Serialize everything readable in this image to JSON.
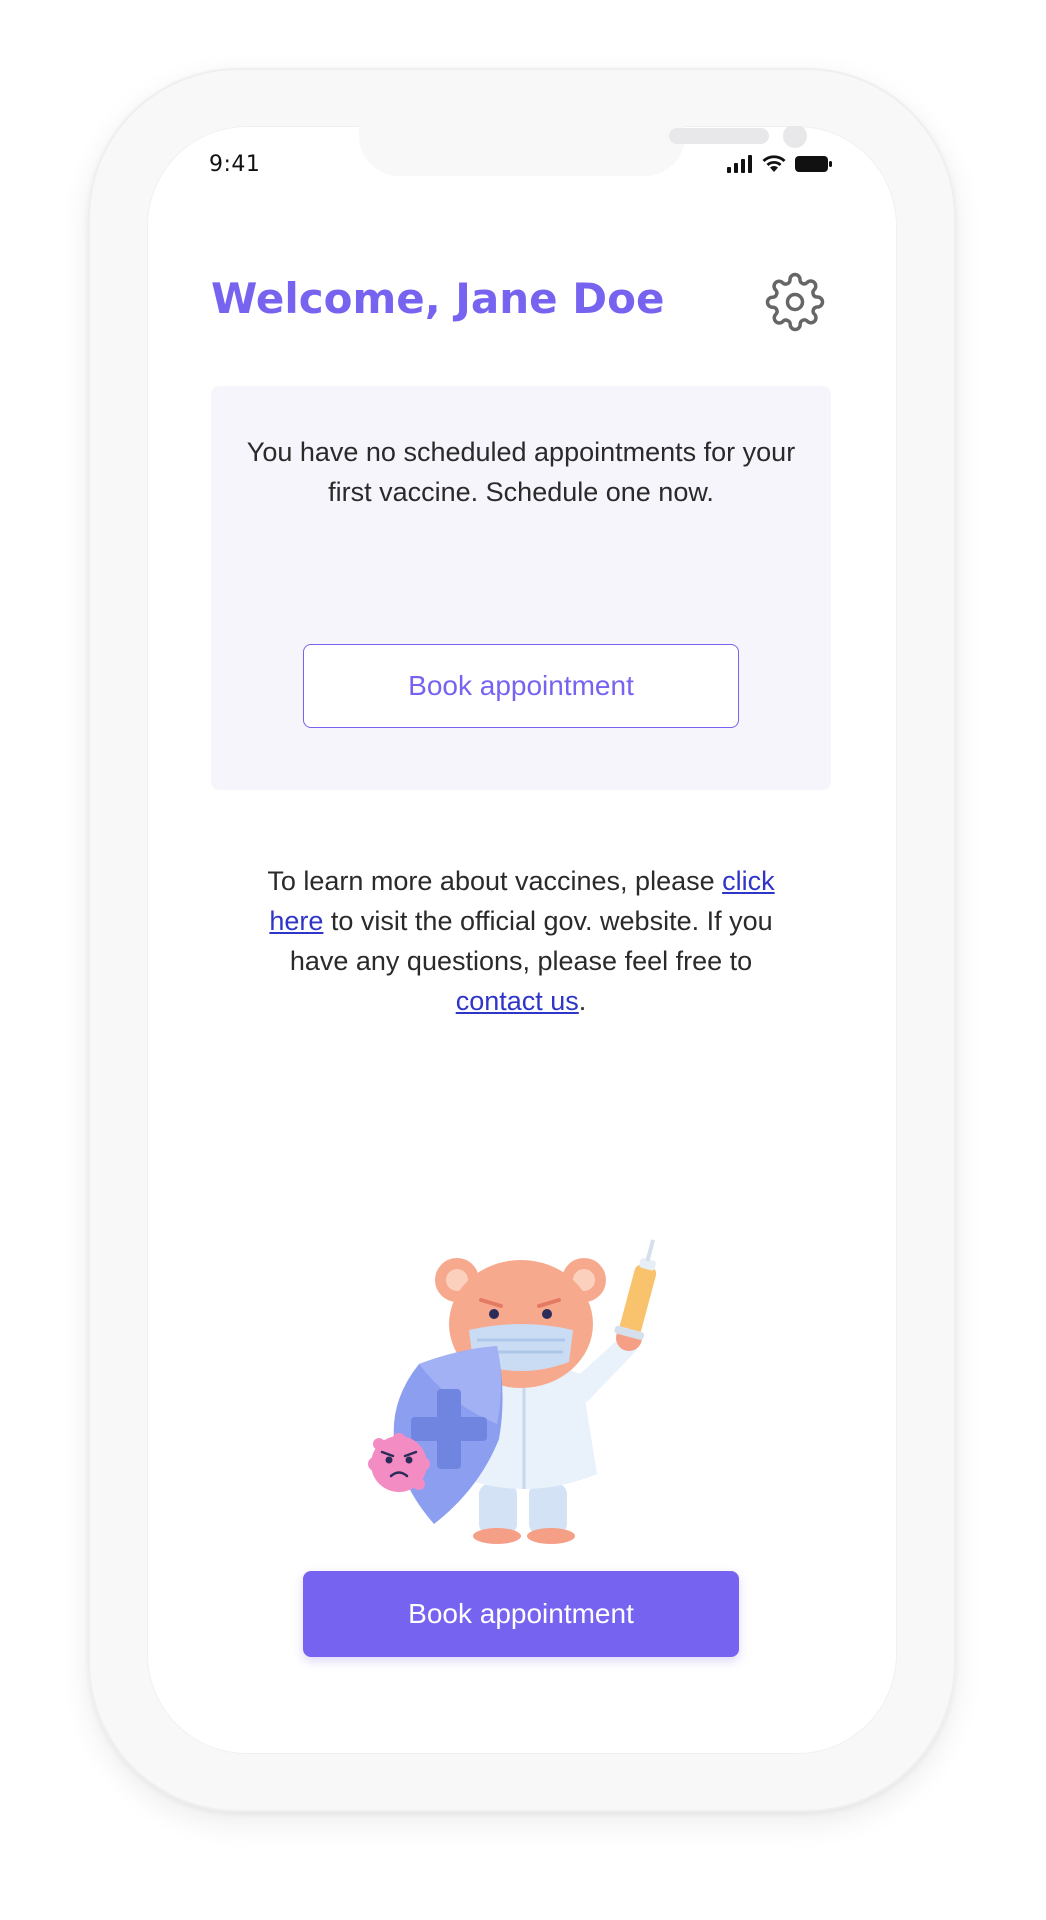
{
  "status_bar": {
    "time": "9:41"
  },
  "header": {
    "welcome_text": "Welcome, Jane Doe"
  },
  "appointment_card": {
    "message": "You have no scheduled appointments for your first vaccine. Schedule one now.",
    "button_label": "Book appointment"
  },
  "info": {
    "text_1": "To learn more about vaccines, please ",
    "link_1": "click here",
    "text_2": " to visit the official gov. website. If you have any questions, please feel free to ",
    "link_2": "contact us",
    "text_3": "."
  },
  "primary_button": {
    "label": "Book appointment"
  },
  "icons": {
    "settings": "gear-icon",
    "signal": "cellular-signal-icon",
    "wifi": "wifi-icon",
    "battery": "battery-icon"
  },
  "colors": {
    "accent": "#7663f0",
    "card_bg": "#f6f5fb",
    "link": "#2f35c7"
  }
}
